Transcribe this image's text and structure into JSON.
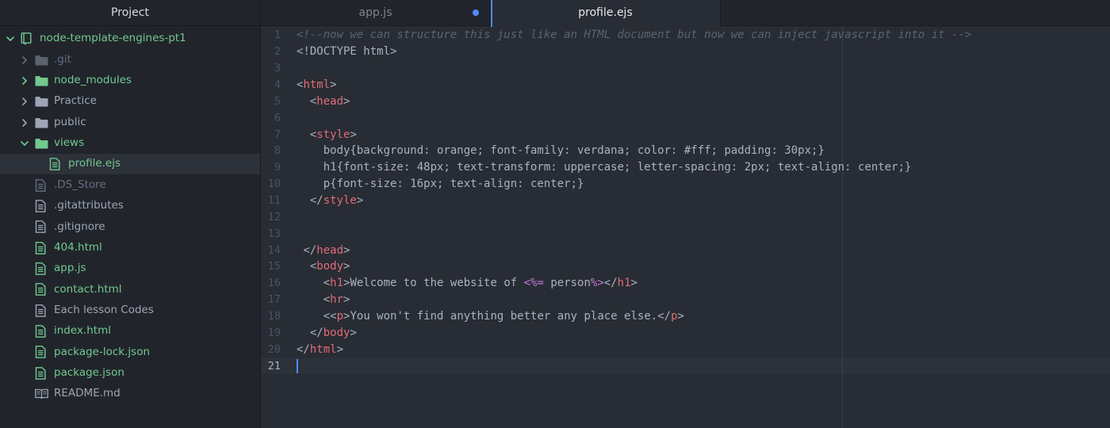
{
  "sidebar": {
    "header": "Project",
    "items": [
      {
        "label": "node-template-engines-pt1",
        "kind": "repo",
        "depth": 0,
        "chevron": "down",
        "status": "added"
      },
      {
        "label": ".git",
        "kind": "folder",
        "depth": 1,
        "chevron": "right",
        "status": "ignored"
      },
      {
        "label": "node_modules",
        "kind": "folder",
        "depth": 1,
        "chevron": "right",
        "status": "added"
      },
      {
        "label": "Practice",
        "kind": "folder",
        "depth": 1,
        "chevron": "right",
        "status": "default"
      },
      {
        "label": "public",
        "kind": "folder",
        "depth": 1,
        "chevron": "right",
        "status": "default"
      },
      {
        "label": "views",
        "kind": "folder",
        "depth": 1,
        "chevron": "down",
        "status": "added"
      },
      {
        "label": "profile.ejs",
        "kind": "file",
        "depth": 2,
        "chevron": "",
        "status": "added",
        "selected": true
      },
      {
        "label": ".DS_Store",
        "kind": "file",
        "depth": 1,
        "chevron": "",
        "status": "ignored"
      },
      {
        "label": ".gitattributes",
        "kind": "file",
        "depth": 1,
        "chevron": "",
        "status": "default"
      },
      {
        "label": ".gitignore",
        "kind": "file",
        "depth": 1,
        "chevron": "",
        "status": "default"
      },
      {
        "label": "404.html",
        "kind": "file",
        "depth": 1,
        "chevron": "",
        "status": "added"
      },
      {
        "label": "app.js",
        "kind": "file",
        "depth": 1,
        "chevron": "",
        "status": "added"
      },
      {
        "label": "contact.html",
        "kind": "file",
        "depth": 1,
        "chevron": "",
        "status": "added"
      },
      {
        "label": "Each lesson Codes",
        "kind": "file",
        "depth": 1,
        "chevron": "",
        "status": "default"
      },
      {
        "label": "index.html",
        "kind": "file",
        "depth": 1,
        "chevron": "",
        "status": "added"
      },
      {
        "label": "package-lock.json",
        "kind": "file",
        "depth": 1,
        "chevron": "",
        "status": "added"
      },
      {
        "label": "package.json",
        "kind": "file",
        "depth": 1,
        "chevron": "",
        "status": "added"
      },
      {
        "label": "README.md",
        "kind": "book",
        "depth": 1,
        "chevron": "",
        "status": "default"
      }
    ]
  },
  "tabs": [
    {
      "label": "app.js",
      "active": false,
      "modified": true
    },
    {
      "label": "profile.ejs",
      "active": true,
      "modified": false
    }
  ],
  "editor": {
    "current_line": 21,
    "lines": [
      [
        [
          "c",
          "<!--now we can structure this just like an HTML document but now we can inject javascript into it -->"
        ]
      ],
      [
        [
          "t",
          "<!DOCTYPE html>"
        ]
      ],
      [],
      [
        [
          "p",
          "<"
        ],
        [
          "g",
          "html"
        ],
        [
          "p",
          ">"
        ]
      ],
      [
        [
          "t",
          "  "
        ],
        [
          "p",
          "<"
        ],
        [
          "g",
          "head"
        ],
        [
          "p",
          ">"
        ]
      ],
      [],
      [
        [
          "t",
          "  "
        ],
        [
          "p",
          "<"
        ],
        [
          "g",
          "style"
        ],
        [
          "p",
          ">"
        ]
      ],
      [
        [
          "t",
          "    body{background: orange; font-family: verdana; color: #fff; padding: 30px;}"
        ]
      ],
      [
        [
          "t",
          "    h1{font-size: 48px; text-transform: uppercase; letter-spacing: 2px; text-align: center;}"
        ]
      ],
      [
        [
          "t",
          "    p{font-size: 16px; text-align: center;}"
        ]
      ],
      [
        [
          "t",
          "  "
        ],
        [
          "p",
          "</"
        ],
        [
          "g",
          "style"
        ],
        [
          "p",
          ">"
        ]
      ],
      [],
      [],
      [
        [
          "t",
          " "
        ],
        [
          "p",
          "</"
        ],
        [
          "g",
          "head"
        ],
        [
          "p",
          ">"
        ]
      ],
      [
        [
          "t",
          "  "
        ],
        [
          "p",
          "<"
        ],
        [
          "g",
          "body"
        ],
        [
          "p",
          ">"
        ]
      ],
      [
        [
          "t",
          "    "
        ],
        [
          "p",
          "<"
        ],
        [
          "g",
          "h1"
        ],
        [
          "p",
          ">"
        ],
        [
          "t",
          "Welcome to the website of "
        ],
        [
          "e",
          "<%="
        ],
        [
          "t",
          " person"
        ],
        [
          "e",
          "%>"
        ],
        [
          "p",
          "</"
        ],
        [
          "g",
          "h1"
        ],
        [
          "p",
          ">"
        ]
      ],
      [
        [
          "t",
          "    "
        ],
        [
          "p",
          "<"
        ],
        [
          "g",
          "hr"
        ],
        [
          "p",
          ">"
        ]
      ],
      [
        [
          "t",
          "    <"
        ],
        [
          "p",
          "<"
        ],
        [
          "g",
          "p"
        ],
        [
          "p",
          ">"
        ],
        [
          "t",
          "You won't find anything better any place else."
        ],
        [
          "p",
          "</"
        ],
        [
          "g",
          "p"
        ],
        [
          "p",
          ">"
        ]
      ],
      [
        [
          "t",
          "  "
        ],
        [
          "p",
          "</"
        ],
        [
          "g",
          "body"
        ],
        [
          "p",
          ">"
        ]
      ],
      [
        [
          "p",
          "</"
        ],
        [
          "g",
          "html"
        ],
        [
          "p",
          ">"
        ]
      ],
      []
    ]
  },
  "colors": {
    "accent": "#528bff",
    "vcs_added": "#73c990",
    "vcs_ignored": "#636d83",
    "tag": "#e06c75",
    "ejs": "#c678dd",
    "comment": "#5c6370"
  }
}
